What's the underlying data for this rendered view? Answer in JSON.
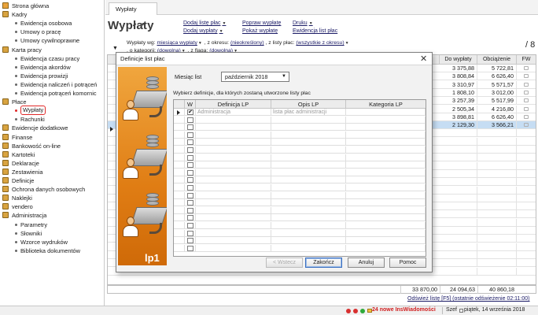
{
  "sidebar": {
    "items": [
      {
        "label": "Strona główna",
        "level": 0,
        "icon": "home-icon"
      },
      {
        "label": "Kadry",
        "level": 0,
        "icon": "folder-icon"
      },
      {
        "label": "Ewidencja osobowa",
        "level": 1
      },
      {
        "label": "Umowy o pracę",
        "level": 1
      },
      {
        "label": "Umowy cywilnoprawne",
        "level": 1
      },
      {
        "label": "Karta pracy",
        "level": 0,
        "icon": "folder-icon"
      },
      {
        "label": "Ewidencja czasu pracy",
        "level": 1
      },
      {
        "label": "Ewidencja akordów",
        "level": 1
      },
      {
        "label": "Ewidencja prowizji",
        "level": 1
      },
      {
        "label": "Ewidencja naliczeń i potrąceń",
        "level": 1
      },
      {
        "label": "Ewidencja potrąceń komornic",
        "level": 1
      },
      {
        "label": "Płace",
        "level": 0,
        "icon": "folder-icon"
      },
      {
        "label": "Wypłaty",
        "level": 1,
        "selected": true
      },
      {
        "label": "Rachunki",
        "level": 1
      },
      {
        "label": "Ewidencje dodatkowe",
        "level": 0,
        "icon": "folder-icon"
      },
      {
        "label": "Finanse",
        "level": 0,
        "icon": "folder-icon"
      },
      {
        "label": "Bankowość on-line",
        "level": 0,
        "icon": "folder-icon"
      },
      {
        "label": "Kartoteki",
        "level": 0,
        "icon": "folder-icon"
      },
      {
        "label": "Deklaracje",
        "level": 0,
        "icon": "folder-icon"
      },
      {
        "label": "Zestawienia",
        "level": 0,
        "icon": "folder-icon"
      },
      {
        "label": "Definicje",
        "level": 0,
        "icon": "folder-icon"
      },
      {
        "label": "Ochrona danych osobowych",
        "level": 0,
        "icon": "folder-icon"
      },
      {
        "label": "Naklejki",
        "level": 0,
        "icon": "folder-icon"
      },
      {
        "label": "vendero",
        "level": 0,
        "icon": "folder-icon"
      },
      {
        "label": "Administracja",
        "level": 0,
        "icon": "folder-icon"
      },
      {
        "label": "Parametry",
        "level": 1
      },
      {
        "label": "Słowniki",
        "level": 1
      },
      {
        "label": "Wzorce wydruków",
        "level": 1
      },
      {
        "label": "Biblioteka dokumentów",
        "level": 1
      }
    ]
  },
  "tab": {
    "label": "Wypłaty"
  },
  "header": {
    "title": "Wypłaty",
    "page_count": "/ 8",
    "actions": {
      "dodaj_liste": "Dodaj listę płac",
      "dodaj_wyplaty": "Dodaj wypłaty",
      "popraw": "Popraw wypłatę",
      "pokaz": "Pokaż wypłatę",
      "druku": "Druku",
      "ewidencja": "Ewidencja list płac"
    }
  },
  "filters": {
    "wg_label": "Wypłaty wg:",
    "wg_value": "miesiąca wypłaty",
    "okres_label": ", z okresu:",
    "okres_value": "(nieokreślony)",
    "listy_label": ", z listy płac:",
    "listy_value": "(wszystkie z okresu)",
    "kategorii_label": ", o kategorii:",
    "kategorii_value": "(dowolna)",
    "flaga_label": ", z flagą:",
    "flaga_value": "(dowolna)"
  },
  "grid": {
    "columns": {
      "do_wyplaty": "Do wypłaty",
      "obciazenie": "Obciążenie",
      "fw": "FW"
    },
    "rows": [
      {
        "do_wyplaty": "3 375,88",
        "obciazenie": "5 722,81"
      },
      {
        "do_wyplaty": "3 808,84",
        "obciazenie": "6 626,40"
      },
      {
        "do_wyplaty": "3 310,97",
        "obciazenie": "5 571,57"
      },
      {
        "do_wyplaty": "1 808,10",
        "obciazenie": "3 012,00"
      },
      {
        "do_wyplaty": "3 257,39",
        "obciazenie": "5 517,99"
      },
      {
        "do_wyplaty": "2 505,34",
        "obciazenie": "4 216,80"
      },
      {
        "do_wyplaty": "3 898,81",
        "obciazenie": "6 626,40"
      },
      {
        "do_wyplaty": "2 129,30",
        "obciazenie": "3 566,21"
      }
    ],
    "selected_row": 7
  },
  "totals": {
    "brutto": "33 870,00",
    "do_wyplaty": "24 094,63",
    "obciazenie": "40 860,18"
  },
  "refresh": {
    "label": "Odśwież listę [F5] (ostatnie odświeżenie 02:11:00)"
  },
  "status": {
    "messages": "24 nowe InsWiadomości",
    "user": "Szef",
    "date": "piątek, 14 września 2018"
  },
  "dialog": {
    "title": "Definicje list płac",
    "close_glyph": "✕",
    "month_label": "Miesiąc list",
    "month_value": "październik 2018",
    "instruction": "Wybierz definicje, dla których zostaną utworzone listy płac",
    "banner_logo": "lp1",
    "columns": {
      "w": "W",
      "definicja": "Definicja LP",
      "opis": "Opis LP",
      "kategoria": "Kategoria LP"
    },
    "rows": [
      {
        "checked": true,
        "definicja": "Administracja",
        "opis": "lista płac administracji",
        "kategoria": ""
      }
    ],
    "check_glyph": "✔",
    "buttons": {
      "back": "< Wstecz",
      "finish": "Zakończ",
      "cancel": "Anuluj",
      "help": "Pomoc"
    }
  },
  "colors": {
    "accent": "#2a62b5",
    "selection": "#c6ddf3",
    "banner": "#e07d14",
    "alert": "#d01e1e"
  }
}
